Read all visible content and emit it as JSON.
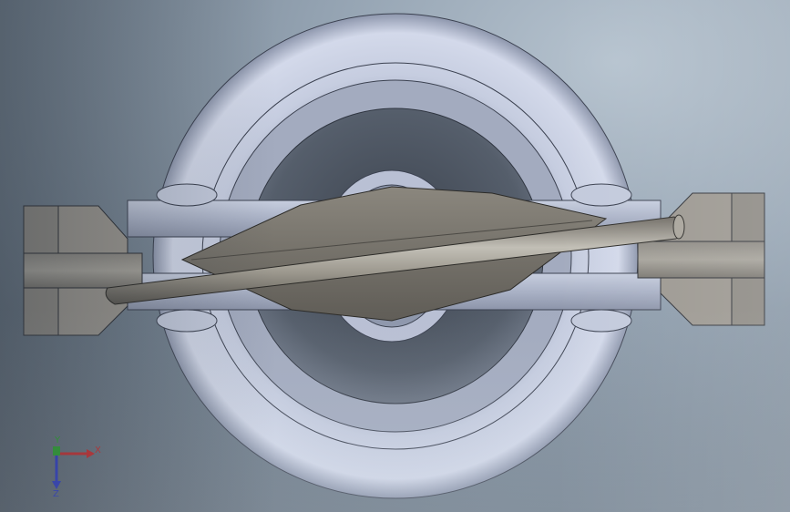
{
  "view": {
    "background_top": "#b6c3cf",
    "background_bottom": "#545f6b"
  },
  "model": {
    "part_color": "#bfc6d8",
    "part_shadow": "#7f889e",
    "spindle_color": "#9a968c",
    "spindle_dark": "#6e6b64"
  },
  "triad": {
    "x_label": "X",
    "y_label": "Y",
    "z_label": "Z",
    "x_color": "#d21a1a",
    "y_color": "#1aa81a",
    "z_color": "#1a2ad2"
  }
}
